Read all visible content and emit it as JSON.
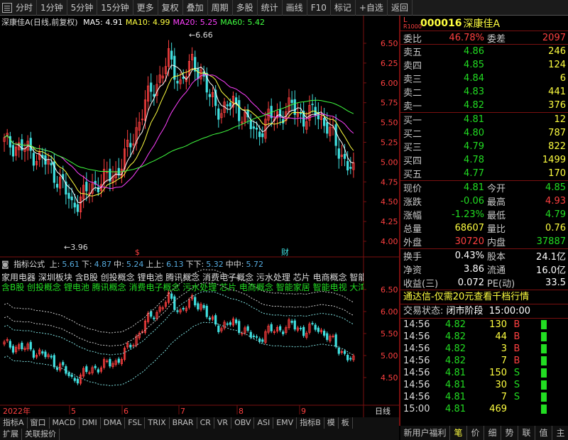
{
  "toolbar": {
    "items": [
      "分时",
      "1分钟",
      "5分钟",
      "15分钟",
      "更多",
      "复权",
      "叠加",
      "画线",
      "F10",
      "标记",
      "+自选",
      "返回"
    ],
    "hidden_items": [
      "周期",
      "多股",
      "统计"
    ]
  },
  "main_chart": {
    "title": "深康佳A(日线,前复权)",
    "ma": [
      {
        "label": "MA5:",
        "value": "4.91",
        "color": "#ffffff"
      },
      {
        "label": "MA10:",
        "value": "4.99",
        "color": "#ffff40"
      },
      {
        "label": "MA20:",
        "value": "5.25",
        "color": "#ff40ff"
      },
      {
        "label": "MA60:",
        "value": "5.42",
        "color": "#40ff40"
      }
    ],
    "price_ticks": [
      "6.50",
      "6.25",
      "6.00",
      "5.75",
      "5.50",
      "5.25",
      "5.00",
      "4.75",
      "4.50",
      "4.25",
      "4.00"
    ],
    "high_mark": "6.66",
    "low_mark": "3.96",
    "marker_s": "$",
    "marker_cai": "财"
  },
  "sub_chart": {
    "name": "指标公式",
    "values": [
      {
        "label": "上:",
        "value": "5.61"
      },
      {
        "label": "下:",
        "value": "4.87"
      },
      {
        "label": "中:",
        "value": "5.24"
      },
      {
        "label": "上上:",
        "value": "6.13"
      },
      {
        "label": "下下:",
        "value": "5.32"
      },
      {
        "label": "中中:",
        "value": "5.72"
      }
    ],
    "concepts_white": "家用电器 深圳板块 含B股 创投概念 锂电池 腾讯概念 消费电子概念 污水处理 芯片 电商概念 智能",
    "concepts_green": "含B股 创投概念 锂电池 腾讯概念 消费电子概念 污水处理 芯片 电商概念 智能家居 智能电视 大湾区",
    "ticks": [
      "6.50",
      "6.00",
      "5.50",
      "5.00",
      "4.50"
    ]
  },
  "date_axis": {
    "year": "2022年",
    "months": [
      "5",
      "6",
      "7",
      "8",
      "9"
    ],
    "period": "日线"
  },
  "indicator_tabs": [
    "指标A",
    "窗口",
    "MACD",
    "DMI",
    "DMA",
    "FSL",
    "TRIX",
    "BRAR",
    "CR",
    "VR",
    "OBV",
    "ASI",
    "EMV",
    "指标B",
    "模",
    "板"
  ],
  "bottom_tabs": [
    "扩展",
    "关联报价"
  ],
  "bottom_right_tabs": [
    "新用户福利专享",
    "笔",
    "价",
    "细",
    "势",
    "联",
    "值",
    "主"
  ],
  "quote": {
    "code": "000016",
    "name": "深康佳A",
    "lr_top": "L",
    "lr_bottom": "R",
    "lr_sub": "1000",
    "weibi_label": "委比",
    "weibi": "46.78%",
    "weicha_label": "委差",
    "weicha": "2097",
    "asks": [
      {
        "label": "卖五",
        "price": "4.86",
        "vol": "246"
      },
      {
        "label": "卖四",
        "price": "4.85",
        "vol": "124"
      },
      {
        "label": "卖三",
        "price": "4.84",
        "vol": "6"
      },
      {
        "label": "卖二",
        "price": "4.83",
        "vol": "441"
      },
      {
        "label": "卖一",
        "price": "4.82",
        "vol": "376"
      }
    ],
    "bids": [
      {
        "label": "买一",
        "price": "4.81",
        "vol": "12"
      },
      {
        "label": "买二",
        "price": "4.80",
        "vol": "787"
      },
      {
        "label": "买三",
        "price": "4.79",
        "vol": "822"
      },
      {
        "label": "买四",
        "price": "4.78",
        "vol": "1499"
      },
      {
        "label": "买五",
        "price": "4.77",
        "vol": "170"
      }
    ],
    "stats": [
      {
        "l1": "现价",
        "v1": "4.81",
        "c1": "green",
        "l2": "今开",
        "v2": "4.85",
        "c2": "green"
      },
      {
        "l1": "涨跌",
        "v1": "-0.06",
        "c1": "green",
        "l2": "最高",
        "v2": "4.93",
        "c2": "red"
      },
      {
        "l1": "涨幅",
        "v1": "-1.23%",
        "c1": "green",
        "l2": "最低",
        "v2": "4.79",
        "c2": "green"
      },
      {
        "l1": "总量",
        "v1": "68607",
        "c1": "yellow",
        "l2": "量比",
        "v2": "0.76",
        "c2": "yellow"
      },
      {
        "l1": "外盘",
        "v1": "30720",
        "c1": "red",
        "l2": "内盘",
        "v2": "37887",
        "c2": "green"
      }
    ],
    "stats2": [
      {
        "l1": "换手",
        "v1": "0.43%",
        "l2": "股本",
        "v2": "24.1亿"
      },
      {
        "l1": "净资",
        "v1": "3.86",
        "l2": "流通",
        "v2": "16.0亿"
      },
      {
        "l1": "收益(三)",
        "v1": "0.072",
        "l2": "PE(动)",
        "v2": "33.5"
      }
    ],
    "notice": "通达信-仅需20元查看千档行情",
    "status_label": "交易状态:",
    "status_value": "闭市阶段",
    "status_time": "15:00:00",
    "trades": [
      {
        "time": "14:56",
        "price": "4.82",
        "qty": "130",
        "flag": "B"
      },
      {
        "time": "14:56",
        "price": "4.82",
        "qty": "44",
        "flag": "B"
      },
      {
        "time": "14:56",
        "price": "4.82",
        "qty": "3",
        "flag": "B"
      },
      {
        "time": "14:56",
        "price": "4.82",
        "qty": "7",
        "flag": "B"
      },
      {
        "time": "14:56",
        "price": "4.81",
        "qty": "150",
        "flag": "S"
      },
      {
        "time": "14:56",
        "price": "4.81",
        "qty": "30",
        "flag": "S"
      },
      {
        "time": "14:56",
        "price": "4.81",
        "qty": "7",
        "flag": "S"
      },
      {
        "time": "15:00",
        "price": "4.81",
        "qty": "469",
        "flag": ""
      }
    ]
  },
  "colors": {
    "up": "#ff4040",
    "down": "#40e0e0",
    "ma5": "#ffffff",
    "ma10": "#ffff40",
    "ma20": "#ff40ff",
    "ma60": "#40ff40"
  }
}
